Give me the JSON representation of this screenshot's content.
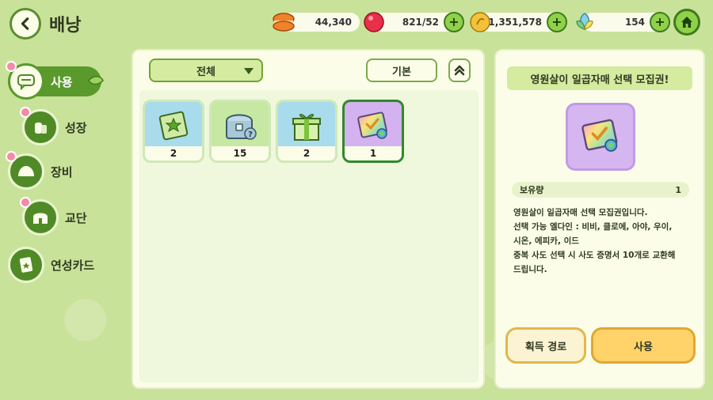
{
  "header": {
    "title": "배낭",
    "currencies": [
      {
        "icon": "macaron-icon",
        "value": "44,340",
        "has_plus": false,
        "color": "#f0822a"
      },
      {
        "icon": "candy-icon",
        "value": "821/52",
        "has_plus": true,
        "color": "#e8304a"
      },
      {
        "icon": "gold-coin-icon",
        "value": "1,351,578",
        "has_plus": true,
        "color": "#f3c23a"
      },
      {
        "icon": "crystal-leaf-icon",
        "value": "154",
        "has_plus": true,
        "color": "#8ad0e8"
      }
    ],
    "plus_label": "+"
  },
  "sidebar": {
    "items": [
      {
        "label": "사용",
        "icon": "chat-icon",
        "active": true
      },
      {
        "label": "성장",
        "icon": "potion-icon",
        "active": false
      },
      {
        "label": "장비",
        "icon": "equipment-icon",
        "active": false
      },
      {
        "label": "교단",
        "icon": "temple-icon",
        "active": false
      },
      {
        "label": "연성카드",
        "icon": "card-icon",
        "active": false
      }
    ]
  },
  "main": {
    "filter": {
      "selected": "전체"
    },
    "sort_label": "기본",
    "items": [
      {
        "icon": "green-star-card-icon",
        "count": "2",
        "bg": "#a8dcec",
        "selected": false
      },
      {
        "icon": "treasure-chest-icon",
        "count": "15",
        "bg": "#c6e8a2",
        "selected": false
      },
      {
        "icon": "gift-box-icon",
        "count": "2",
        "bg": "#a8dcec",
        "selected": false
      },
      {
        "icon": "rainbow-ticket-icon",
        "count": "1",
        "bg": "#d3b2ef",
        "selected": true
      }
    ]
  },
  "detail": {
    "title": "영원살이 일곱자매 선택 모집권!",
    "owned_label": "보유량",
    "owned_value": "1",
    "description": [
      "영원살이 일곱자매 선택 모집권입니다.",
      "선택 가능 엘다인 : 비비, 클로에, 아야, 우이,",
      "시온, 에피카, 이드",
      "중복 사도 선택 시 사도 증명서 10개로 교환해",
      "드립니다."
    ],
    "acquire_label": "획득 경로",
    "use_label": "사용"
  },
  "colors": {
    "background": "#c9e29a",
    "accent_green": "#5a9a2c",
    "use_button": "#ffd26a",
    "selected_border": "#2f8a2a"
  }
}
